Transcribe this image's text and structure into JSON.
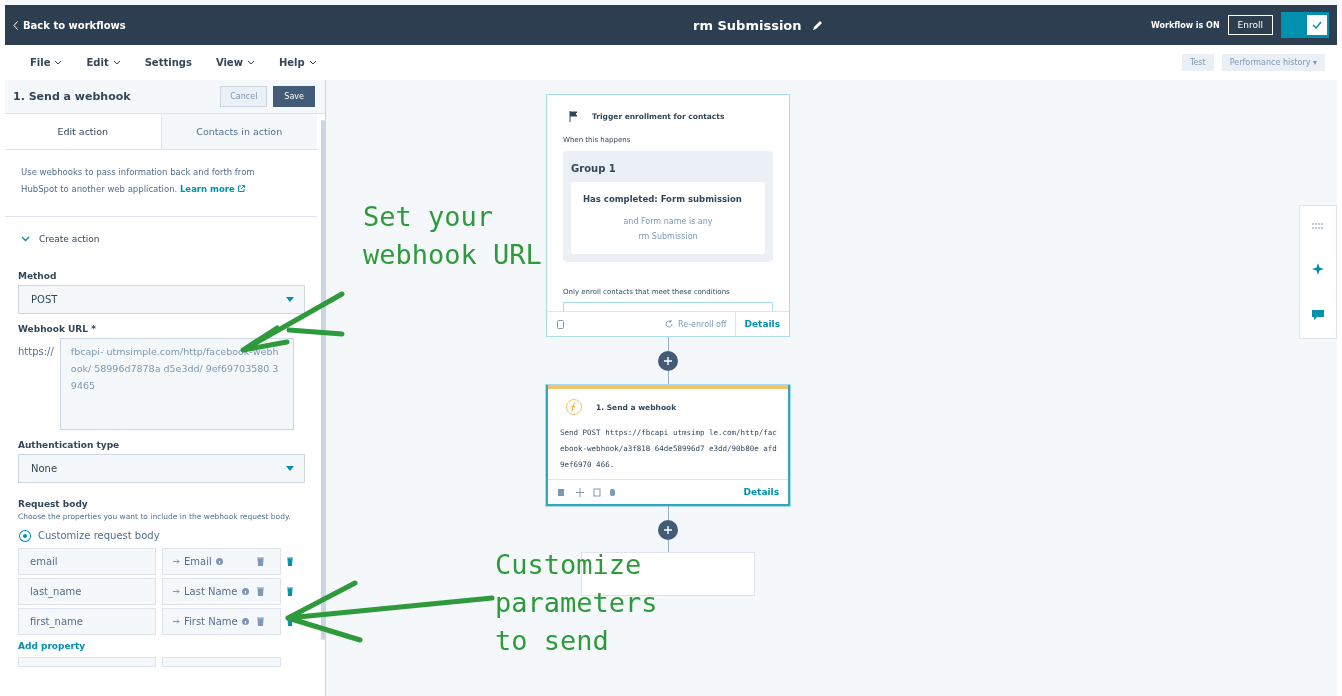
{
  "header": {
    "back": "Back to workflows",
    "title": "rm Submission",
    "status": "Workflow is ON",
    "enroll": "Enroll",
    "toggle_on": true
  },
  "menu": [
    {
      "label": "File",
      "dropdown": true
    },
    {
      "label": "Edit",
      "dropdown": true
    },
    {
      "label": "Settings",
      "dropdown": false
    },
    {
      "label": "View",
      "dropdown": true
    },
    {
      "label": "Help",
      "dropdown": true
    }
  ],
  "toolbar": {
    "test": "Test",
    "history": "Performance history ▾"
  },
  "panel": {
    "title": "1. Send a webhook",
    "cancel": "Cancel",
    "save": "Save",
    "tabs": [
      {
        "label": "Edit action",
        "selected": true
      },
      {
        "label": "Contacts in action",
        "selected": false
      }
    ],
    "description": "Use webhooks to pass information back and forth from HubSpot to another web application.",
    "learn_more": "Learn more",
    "section": {
      "label": "Create action",
      "expanded": true
    },
    "method": {
      "label": "Method",
      "value": "POST"
    },
    "url": {
      "label": "Webhook URL *",
      "prefix": "https://",
      "value": "fbcapi- utmsimple.com/http/facebook-webhook/ 58996d7878a d5e3dd/ 9ef69703580 39465"
    },
    "auth": {
      "label": "Authentication type",
      "value": "None"
    },
    "body": {
      "label": "Request body",
      "hint": "Choose the properties you want to include in the webhook request body.",
      "option": "Customize request body",
      "option_selected": true,
      "rows": [
        {
          "key": "email",
          "property": "Email"
        },
        {
          "key": "last_name",
          "property": "Last Name"
        },
        {
          "key": "first_name",
          "property": "First Name"
        }
      ],
      "add": "Add property"
    }
  },
  "canvas": {
    "trigger": {
      "title": "Trigger enrollment for contacts",
      "when": "When this happens",
      "group": "Group 1",
      "condition": "Has completed: Form submission",
      "detail_1": "and Form name is any",
      "detail_2": "rm Submission",
      "only": "Only enroll contacts that meet these conditions",
      "reenroll": "Re-enroll off",
      "details": "Details"
    },
    "action": {
      "title": "1. Send a webhook",
      "body": "Send POST https://fbcapi utmsimp le.com/http/facebook-webhook/a3f818 64de58996d7 e3dd/90b80e afd9ef6970 466.",
      "details": "Details"
    }
  },
  "annotations": [
    {
      "lines": [
        "Set your",
        "webhook URL"
      ]
    },
    {
      "lines": [
        "Customize",
        "parameters",
        "to send"
      ]
    }
  ]
}
